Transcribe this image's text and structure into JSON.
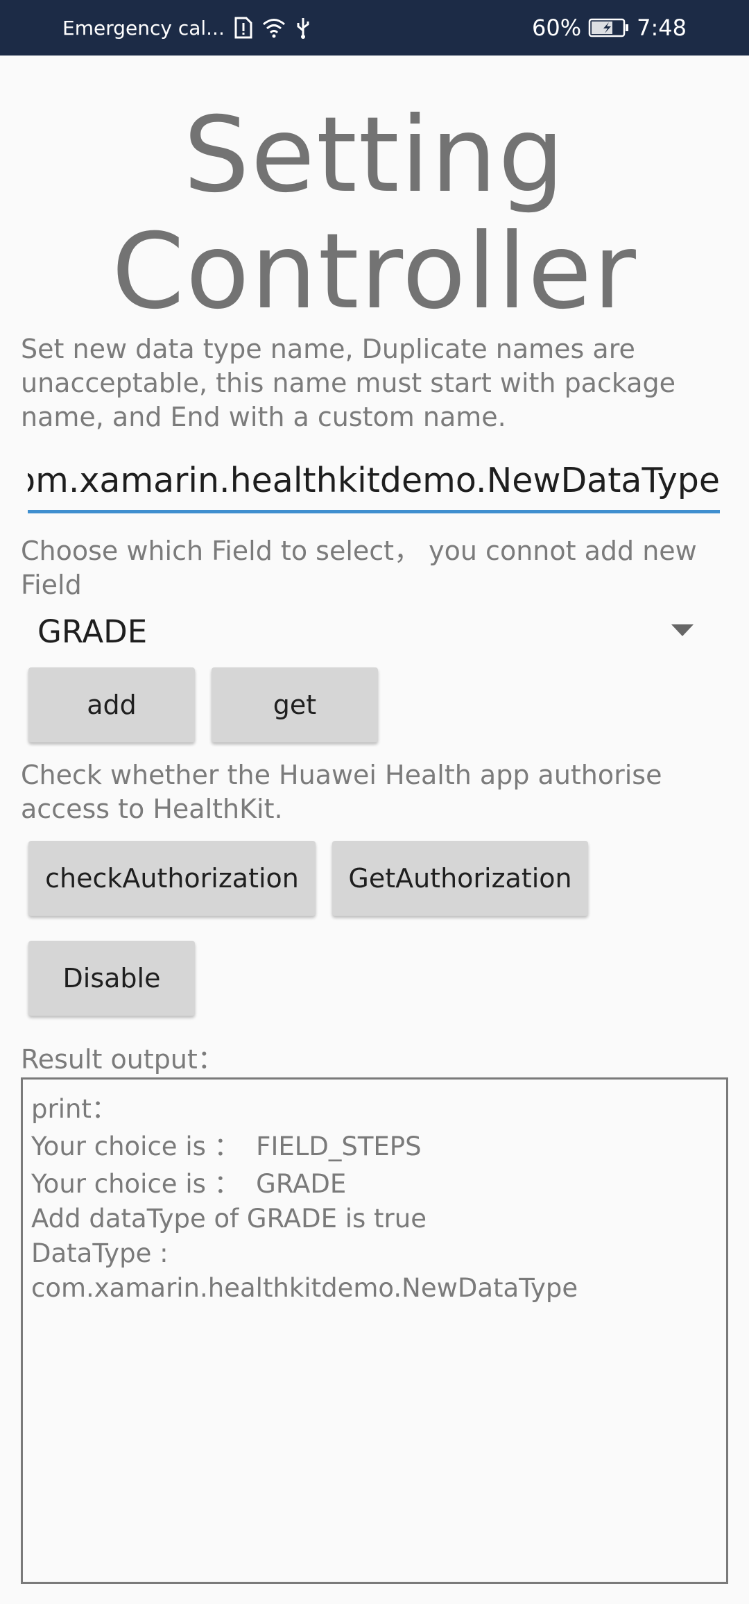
{
  "status_bar": {
    "carrier_text": "Emergency cal...",
    "battery_percent": "60%",
    "time": "7:48",
    "icons": [
      "sim-alert-icon",
      "wifi-icon",
      "usb-icon",
      "battery-charging-icon"
    ]
  },
  "title": {
    "line1": "Setting",
    "line2": "Controller"
  },
  "datatype_section": {
    "description": "Set new data type name, Duplicate names are unacceptable, this name must start with package name, and End with a custom name.",
    "input_value": "com.xamarin.healthkitdemo.NewDataType"
  },
  "field_section": {
    "description": "Choose which Field to select，  you connot add new Field",
    "selected_field": "GRADE",
    "add_label": "add",
    "get_label": "get"
  },
  "auth_section": {
    "description": "Check whether the Huawei Health app authorise access to HealthKit.",
    "check_label": "checkAuthorization",
    "get_auth_label": "GetAuthorization",
    "disable_label": "Disable"
  },
  "result_section": {
    "label": "Result output：",
    "lines": [
      "print：",
      "Your choice is ：  FIELD_STEPS",
      "Your choice is ：  GRADE",
      "Add dataType of GRADE is true",
      "DataType :",
      "com.xamarin.healthkitdemo.NewDataType"
    ]
  },
  "colors": {
    "status_bar_bg": "#1c2b46",
    "input_underline": "#3f8fcf",
    "button_bg": "#d6d6d6"
  }
}
